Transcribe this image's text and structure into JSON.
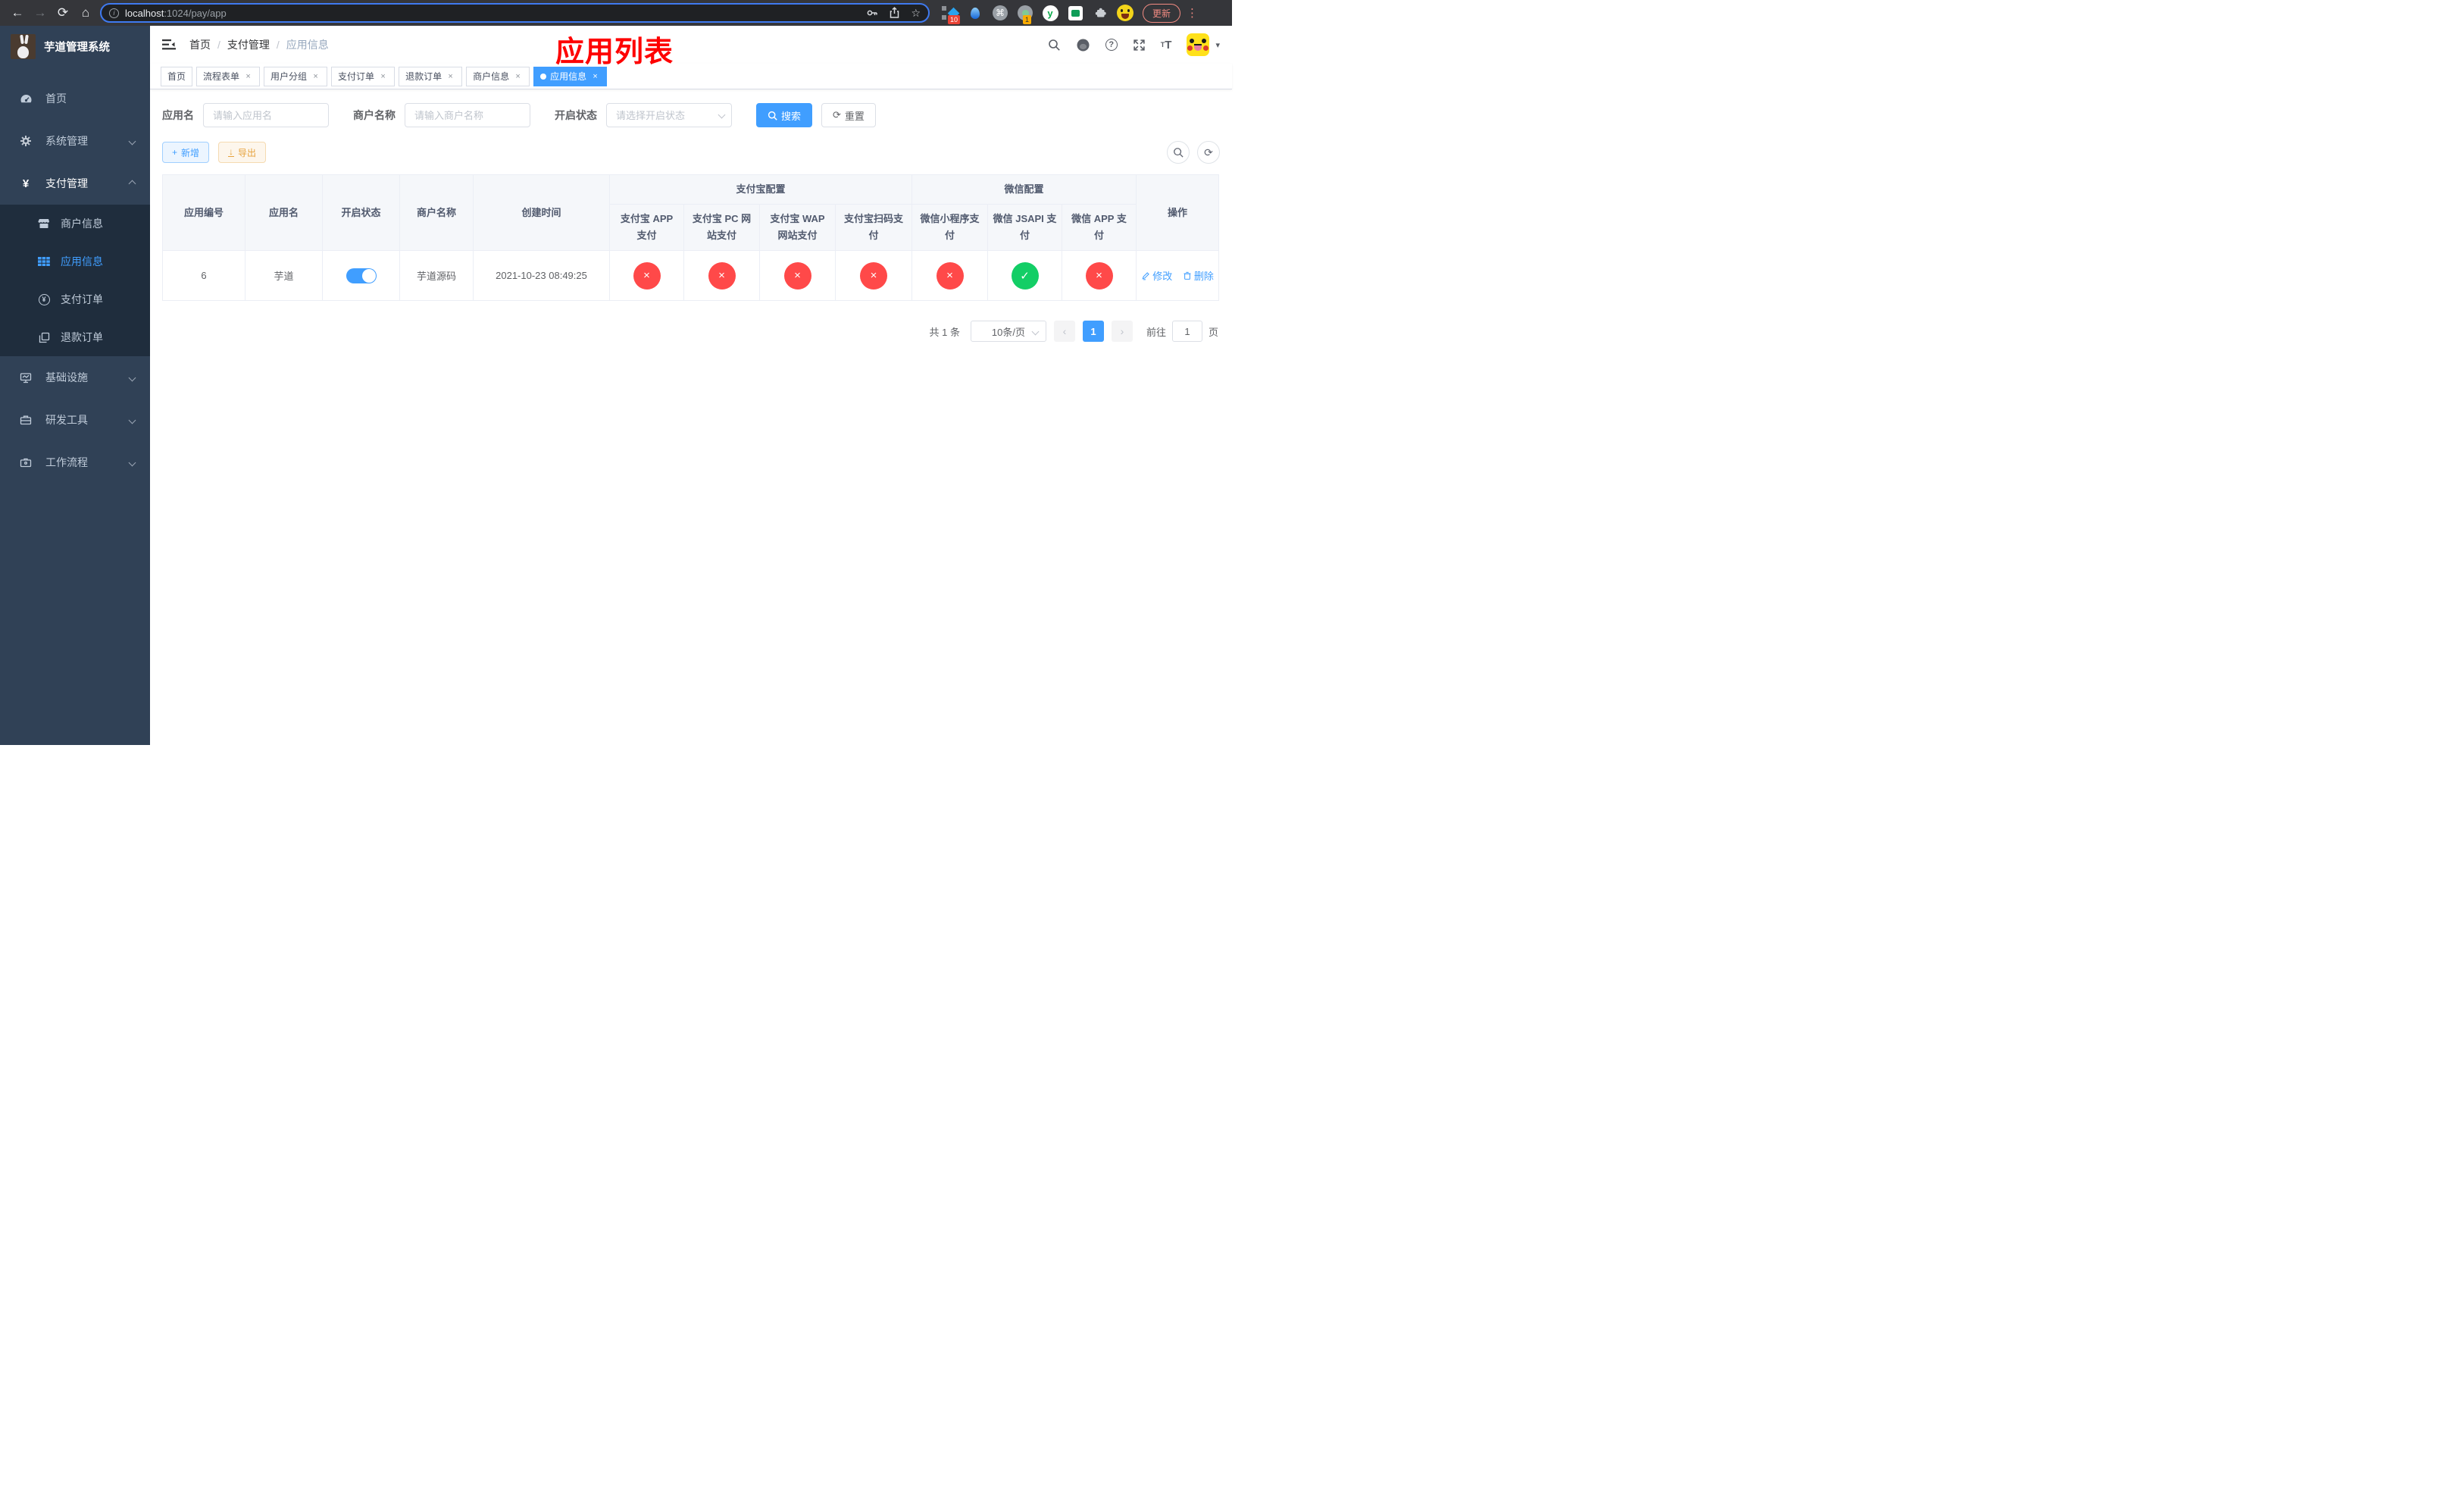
{
  "browser": {
    "back_glyph": "←",
    "forward_glyph": "→",
    "reload_glyph": "⟳",
    "home_glyph": "⌂",
    "url_host": "localhost",
    "url_path": ":1024/pay/app",
    "info_glyph": "i",
    "star_glyph": "☆",
    "cmd_glyph": "⌘",
    "y_ext_letter": "y",
    "ext_badge_blue_diamond": "10",
    "ext_badge_gray_circle": "1",
    "update_label": "更新",
    "menu_dots_glyph": "⋮"
  },
  "sidebar": {
    "title": "芋道管理系统",
    "items": [
      {
        "label": "首页"
      },
      {
        "label": "系统管理"
      },
      {
        "label": "支付管理"
      },
      {
        "label": "商户信息"
      },
      {
        "label": "应用信息"
      },
      {
        "label": "支付订单"
      },
      {
        "label": "退款订单"
      },
      {
        "label": "基础设施"
      },
      {
        "label": "研发工具"
      },
      {
        "label": "工作流程"
      }
    ]
  },
  "navbar": {
    "breadcrumb1": "首页",
    "breadcrumb2": "支付管理",
    "breadcrumb3": "应用信息",
    "sep": "/",
    "annotation": "应用列表",
    "question_glyph": "?",
    "font_icon_small": "T",
    "font_icon_big": "T",
    "caret": "▾"
  },
  "tabs": [
    {
      "label": "首页"
    },
    {
      "label": "流程表单"
    },
    {
      "label": "用户分组"
    },
    {
      "label": "支付订单"
    },
    {
      "label": "退款订单"
    },
    {
      "label": "商户信息"
    },
    {
      "label": "应用信息"
    }
  ],
  "icons": {
    "close": "×",
    "check": "✓",
    "cross": "×",
    "prev": "‹",
    "next": "›",
    "plus": "+",
    "yen": "¥",
    "download": "↓",
    "refresh": "⟳"
  },
  "filters": {
    "app_name_label": "应用名",
    "app_name_placeholder": "请输入应用名",
    "merchant_label": "商户名称",
    "merchant_placeholder": "请输入商户名称",
    "status_label": "开启状态",
    "status_placeholder": "请选择开启状态",
    "search_label": "搜索",
    "reset_label": "重置"
  },
  "actions": {
    "add_label": "新增",
    "export_label": "导出"
  },
  "table": {
    "h_app_id": "应用编号",
    "h_app_name": "应用名",
    "h_status": "开启状态",
    "h_merchant": "商户名称",
    "h_created": "创建时间",
    "h_alipay_group": "支付宝配置",
    "h_wechat_group": "微信配置",
    "h_ops": "操作",
    "h_alipay_app": "支付宝 APP 支付",
    "h_alipay_pc": "支付宝 PC 网站支付",
    "h_alipay_wap": "支付宝 WAP 网站支付",
    "h_alipay_qr": "支付宝扫码支付",
    "h_wx_lite": "微信小程序支付",
    "h_wx_jsapi": "微信 JSAPI 支付",
    "h_wx_app": "微信 APP 支付",
    "row": {
      "id": "6",
      "name": "芋道",
      "enabled": true,
      "merchant": "芋道源码",
      "created": "2021-10-23 08:49:25",
      "statuses": [
        false,
        false,
        false,
        false,
        false,
        true,
        false
      ],
      "edit_label": "修改",
      "delete_label": "删除"
    }
  },
  "pagination": {
    "total": "共 1 条",
    "page_size": "10条/页",
    "current_page": "1",
    "goto_label": "前往",
    "goto_value": "1",
    "page_unit": "页"
  },
  "colors": {
    "primary": "#409eff",
    "success": "#13ce66",
    "danger": "#ff4949",
    "sidebar_bg": "#304156",
    "submenu_bg": "#1f2d3d",
    "annotation": "#fe0000"
  }
}
